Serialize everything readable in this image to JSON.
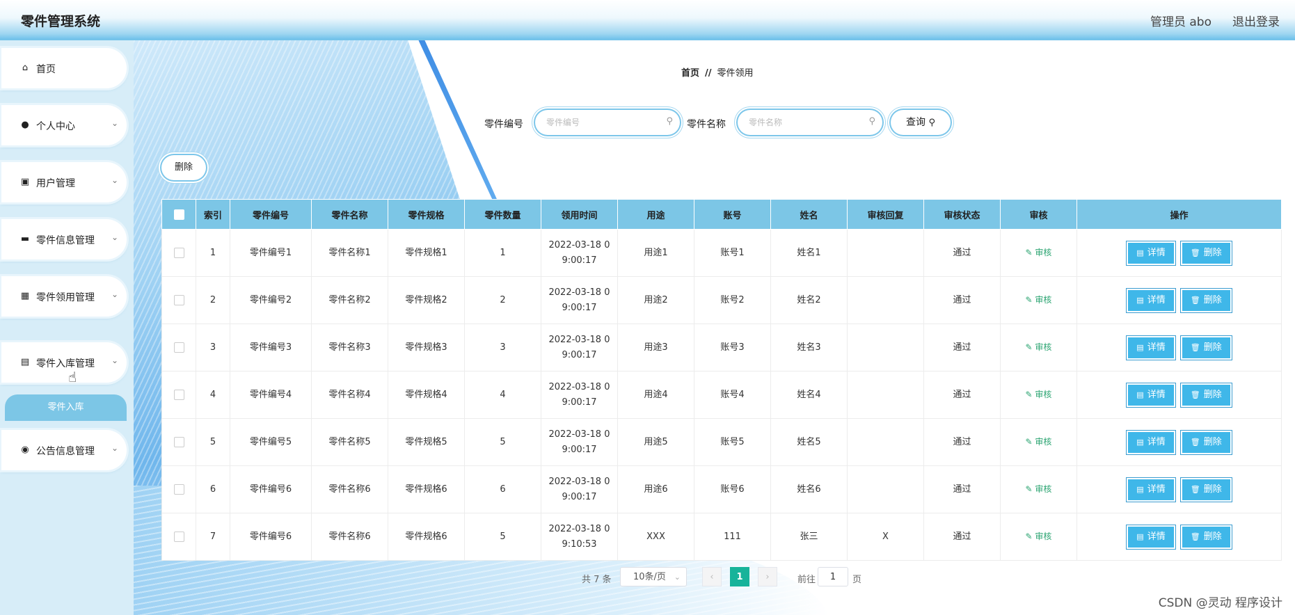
{
  "header": {
    "title": "零件管理系统",
    "admin": "管理员 abo",
    "logout": "退出登录"
  },
  "sidebar": {
    "items": [
      {
        "label": "首页",
        "icon": "home-icon"
      },
      {
        "label": "个人中心",
        "icon": "user-icon"
      },
      {
        "label": "用户管理",
        "icon": "clipboard-icon"
      },
      {
        "label": "零件信息管理",
        "icon": "monitor-icon"
      },
      {
        "label": "零件领用管理",
        "icon": "grid-icon"
      },
      {
        "label": "零件入库管理",
        "icon": "document-icon"
      },
      {
        "label": "公告信息管理",
        "icon": "bulb-icon"
      }
    ],
    "sub_item": "零件入库"
  },
  "breadcrumb": {
    "home": "首页",
    "separator": "//",
    "current": "零件领用"
  },
  "search": {
    "code_label": "零件编号",
    "code_placeholder": "零件编号",
    "name_label": "零件名称",
    "name_placeholder": "零件名称",
    "query_label": "查询"
  },
  "toolbar": {
    "delete_label": "删除"
  },
  "table": {
    "headers": [
      "索引",
      "零件编号",
      "零件名称",
      "零件规格",
      "零件数量",
      "领用时间",
      "用途",
      "账号",
      "姓名",
      "审核回复",
      "审核状态",
      "审核",
      "操作"
    ],
    "audit_label": "审核",
    "detail_label": "详情",
    "delete_label": "删除",
    "rows": [
      {
        "index": "1",
        "code": "零件编号1",
        "name": "零件名称1",
        "spec": "零件规格1",
        "qty": "1",
        "time1": "2022-03-18 0",
        "time2": "9:00:17",
        "use": "用途1",
        "account": "账号1",
        "person": "姓名1",
        "reply": "",
        "status": "通过"
      },
      {
        "index": "2",
        "code": "零件编号2",
        "name": "零件名称2",
        "spec": "零件规格2",
        "qty": "2",
        "time1": "2022-03-18 0",
        "time2": "9:00:17",
        "use": "用途2",
        "account": "账号2",
        "person": "姓名2",
        "reply": "",
        "status": "通过"
      },
      {
        "index": "3",
        "code": "零件编号3",
        "name": "零件名称3",
        "spec": "零件规格3",
        "qty": "3",
        "time1": "2022-03-18 0",
        "time2": "9:00:17",
        "use": "用途3",
        "account": "账号3",
        "person": "姓名3",
        "reply": "",
        "status": "通过"
      },
      {
        "index": "4",
        "code": "零件编号4",
        "name": "零件名称4",
        "spec": "零件规格4",
        "qty": "4",
        "time1": "2022-03-18 0",
        "time2": "9:00:17",
        "use": "用途4",
        "account": "账号4",
        "person": "姓名4",
        "reply": "",
        "status": "通过"
      },
      {
        "index": "5",
        "code": "零件编号5",
        "name": "零件名称5",
        "spec": "零件规格5",
        "qty": "5",
        "time1": "2022-03-18 0",
        "time2": "9:00:17",
        "use": "用途5",
        "account": "账号5",
        "person": "姓名5",
        "reply": "",
        "status": "通过"
      },
      {
        "index": "6",
        "code": "零件编号6",
        "name": "零件名称6",
        "spec": "零件规格6",
        "qty": "6",
        "time1": "2022-03-18 0",
        "time2": "9:00:17",
        "use": "用途6",
        "account": "账号6",
        "person": "姓名6",
        "reply": "",
        "status": "通过"
      },
      {
        "index": "7",
        "code": "零件编号6",
        "name": "零件名称6",
        "spec": "零件规格6",
        "qty": "5",
        "time1": "2022-03-18 0",
        "time2": "9:10:53",
        "use": "XXX",
        "account": "111",
        "person": "张三",
        "reply": "X",
        "status": "通过"
      }
    ]
  },
  "pagination": {
    "total": "共 7 条",
    "page_size": "10条/页",
    "current": "1",
    "goto_label": "前往",
    "goto_value": "1",
    "page_suffix": "页"
  },
  "watermark": "CSDN @灵动 程序设计",
  "colors": {
    "header_accent": "#7cc6ea",
    "table_header": "#7cc6e6",
    "button": "#3fb7e9",
    "pager_active": "#17b39a",
    "audit_link": "#2ba471"
  }
}
